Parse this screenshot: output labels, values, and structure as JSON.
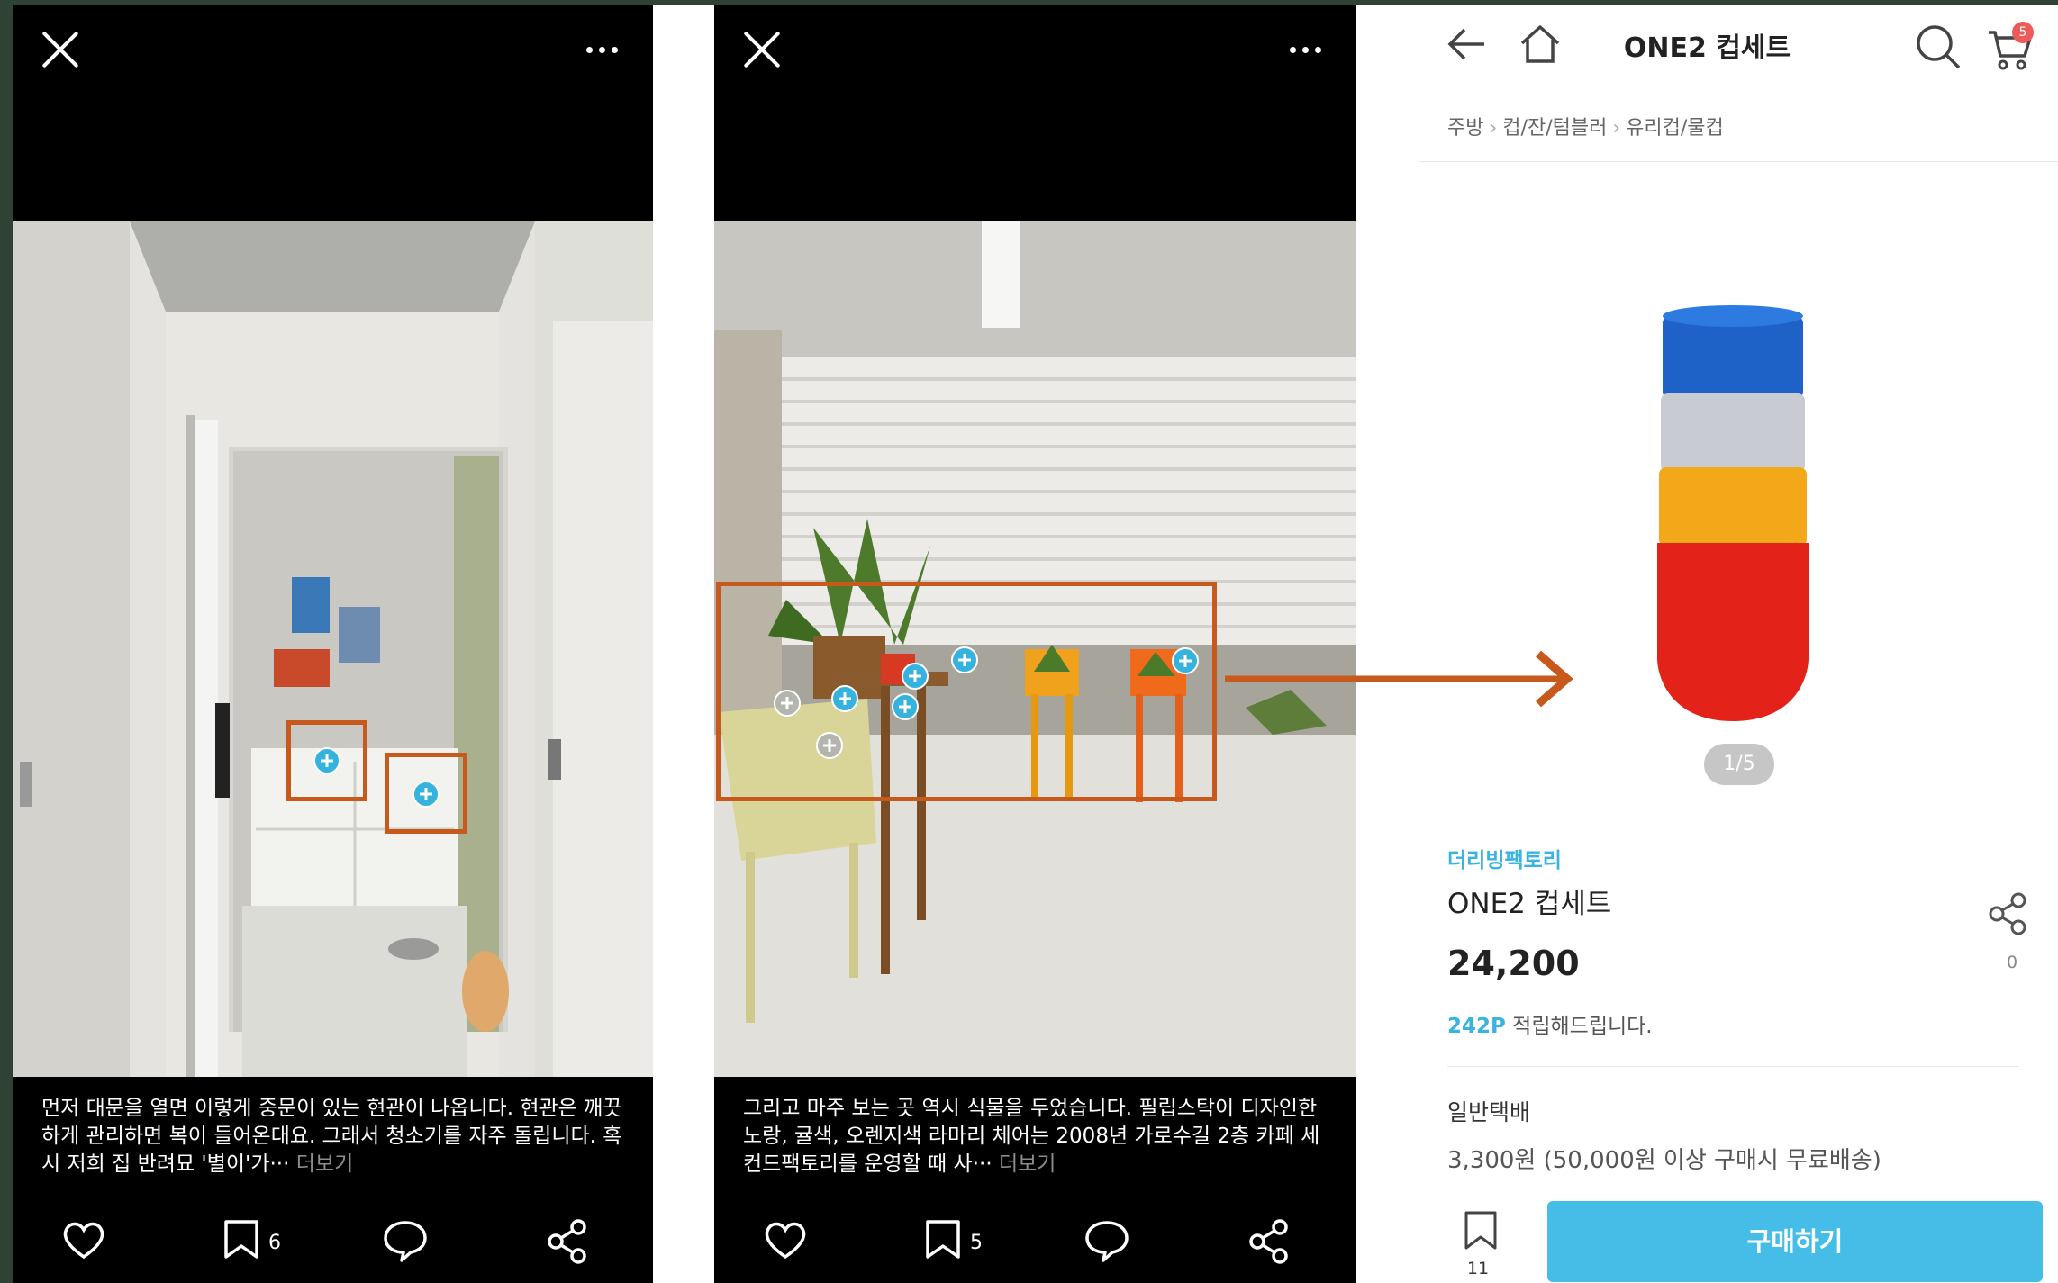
{
  "post1": {
    "caption": "먼저 대문을 열면 이렇게 중문이 있는 현관이 나옵니다. 현관은 깨끗하게 관리하면 복이 들어온대요. 그래서 청소기를 자주 돌립니다. 혹시 저희 집 반려묘 '별이'가···",
    "more": "더보기",
    "bookmark_count": "6"
  },
  "post2": {
    "caption": "그리고 마주 보는 곳 역시 식물을 두었습니다. 필립스탁이 디자인한 노랑, 귤색, 오렌지색 라마리 체어는 2008년 가로수길 2층 카페 세컨드팩토리를 운영할 때 사···",
    "more": "더보기",
    "bookmark_count": "5"
  },
  "product": {
    "header_title": "ONE2 컵세트",
    "cart_badge": "5",
    "breadcrumb": [
      "주방",
      "컵/잔/텀블러",
      "유리컵/물컵"
    ],
    "pager": "1/5",
    "brand": "더리빙팩토리",
    "name": "ONE2 컵세트",
    "price": "24,200",
    "points_value": "242P",
    "points_text": " 적립해드립니다.",
    "share_count": "0",
    "shipping_label": "일반택배",
    "shipping_value": "3,300원 (50,000원 이상 구매시 무료배송)",
    "bookmark_count": "11",
    "buy_label": "구매하기"
  },
  "colors": {
    "accent": "#46bde6",
    "highlight": "#c8591c",
    "frame": "#2e4236"
  }
}
